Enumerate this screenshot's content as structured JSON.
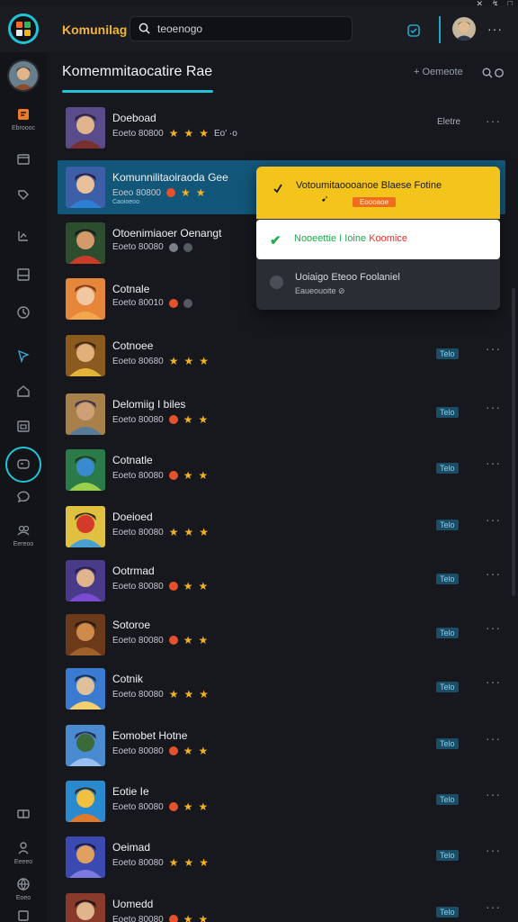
{
  "app": {
    "title": "Komunilag",
    "search_value": "teoenogo",
    "window_controls": [
      "✕",
      "↯",
      "□"
    ],
    "more": "···",
    "logo_colors": [
      "#f06b2a",
      "#2fb457",
      "#e9e9e9",
      "#f3b21f"
    ]
  },
  "rail": {
    "items": [
      {
        "icon": "library-icon",
        "label": "Ebroooc"
      },
      {
        "icon": "window-icon",
        "label": ""
      },
      {
        "icon": "tag-icon",
        "label": ""
      },
      {
        "icon": "chart-icon",
        "label": ""
      },
      {
        "icon": "panel-icon",
        "label": ""
      },
      {
        "icon": "clock-icon",
        "label": ""
      },
      {
        "icon": "cursor-icon",
        "label": ""
      },
      {
        "icon": "home-icon",
        "label": ""
      },
      {
        "icon": "calendar-icon",
        "label": ""
      },
      {
        "icon": "controller-icon",
        "label": ""
      },
      {
        "icon": "chat-icon",
        "label": ""
      },
      {
        "icon": "people-icon",
        "label": "Eereoo"
      },
      {
        "icon": "gift-icon",
        "label": ""
      },
      {
        "icon": "user-icon",
        "label": "Eeeeo"
      },
      {
        "icon": "globe-icon",
        "label": "Eoeo"
      },
      {
        "icon": "settings-icon",
        "label": ""
      }
    ]
  },
  "header": {
    "title": "Komemmitaocatire Rae",
    "action": "+ Oemeote",
    "search_icon": "search-icon",
    "more_icon": "more-icon"
  },
  "list": {
    "rows": [
      {
        "title": "Doeboad",
        "meta": "Eoeto 80800",
        "extra": "Eo' ·o",
        "status": "Eletre",
        "badge": "",
        "stars": 2,
        "sub": ""
      },
      {
        "title": "Komunnilitaoiraoda Gee",
        "meta": "Eoeo 80800",
        "extra": "",
        "status": "",
        "badge": "",
        "stars": 1,
        "sub": "Caoioeoo"
      },
      {
        "title": "Otoenimiaoer Oenangt",
        "meta": "Eoeto 80080",
        "extra": "",
        "status": "",
        "badge": "",
        "stars": 0,
        "sub": ""
      },
      {
        "title": "Cotnale",
        "meta": "Eoeto 80010",
        "extra": "",
        "status": "",
        "badge": "",
        "stars": 0,
        "sub": ""
      },
      {
        "title": "Cotnoee",
        "meta": "Eoeto 80680",
        "extra": "",
        "status": "",
        "badge": "Telo",
        "stars": 2,
        "sub": ""
      },
      {
        "title": "Delomiig I biles",
        "meta": "Eoeto 80080",
        "extra": "",
        "status": "",
        "badge": "Telo",
        "stars": 2,
        "sub": ""
      },
      {
        "title": "Cotnatle",
        "meta": "Eoeto 80080",
        "extra": "",
        "status": "",
        "badge": "Telo",
        "stars": 1,
        "sub": ""
      },
      {
        "title": "Doeioed",
        "meta": "Eoeto 80080",
        "extra": "",
        "status": "",
        "badge": "Telo",
        "stars": 2,
        "sub": ""
      },
      {
        "title": "Ootrmad",
        "meta": "Eoeto 80080",
        "extra": "",
        "status": "",
        "badge": "Telo",
        "stars": 1,
        "sub": ""
      },
      {
        "title": "Sotoroe",
        "meta": "Eoeto 80080",
        "extra": "",
        "status": "",
        "badge": "Telo",
        "stars": 1,
        "sub": ""
      },
      {
        "title": "Cotnik",
        "meta": "Eoeto 80080",
        "extra": "",
        "status": "",
        "badge": "Telo",
        "stars": 2,
        "sub": ""
      },
      {
        "title": "Eomobet Hotne",
        "meta": "Eoeto 80080",
        "extra": "",
        "status": "",
        "badge": "Telo",
        "stars": 1,
        "sub": ""
      },
      {
        "title": "Eotie Ie",
        "meta": "Eoeto 80080",
        "extra": "",
        "status": "",
        "badge": "Telo",
        "stars": 1,
        "sub": ""
      },
      {
        "title": "Oeimad",
        "meta": "Eoeto 80080",
        "extra": "",
        "status": "",
        "badge": "Telo",
        "stars": 2,
        "sub": ""
      },
      {
        "title": "Uomedd",
        "meta": "Eoeto 80080",
        "extra": "",
        "status": "",
        "badge": "Telo",
        "stars": 2,
        "sub": ""
      }
    ]
  },
  "popup": {
    "primary": "Votoumitaoooanoe Blaese Fotine",
    "primary_sub": "Eoooaoe",
    "cursor": "➹",
    "confirm_left": "Nooeettie I Ioine",
    "confirm_right": "Koomice",
    "secondary": "Uoiaigo Eteoo Foolaniel",
    "secondary_sub": "Eaueouoite ⊘"
  }
}
